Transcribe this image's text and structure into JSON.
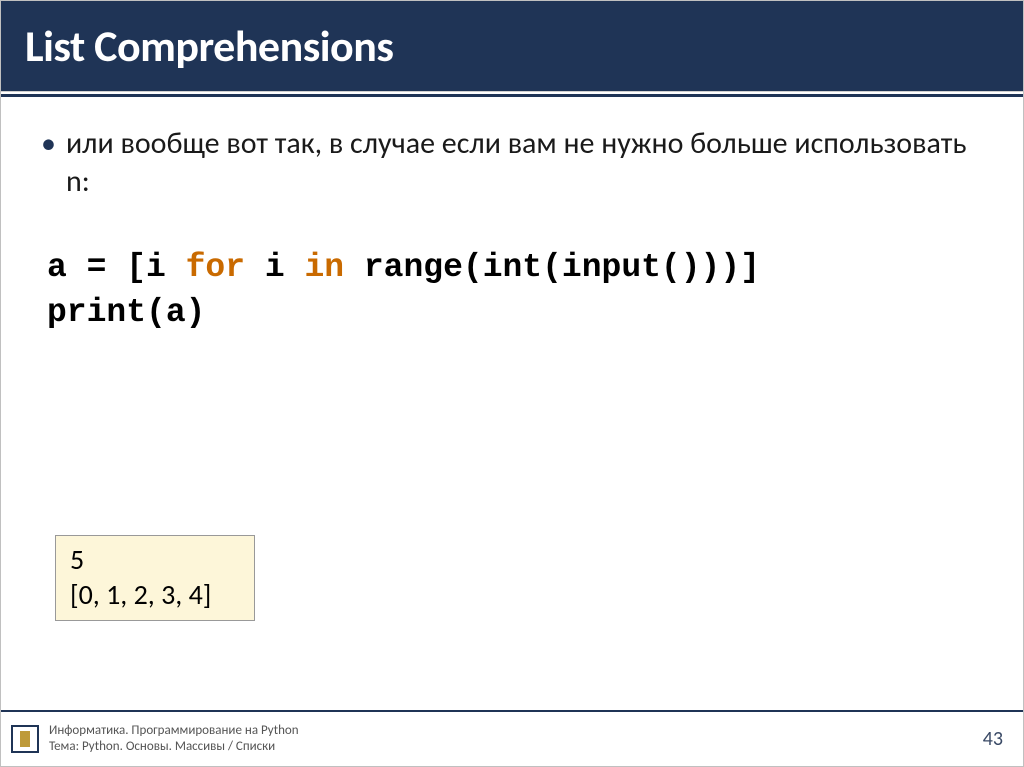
{
  "header": {
    "title": "List Comprehensions"
  },
  "body": {
    "bullet_text": "или вообще вот так, в случае если вам не нужно больше использовать n:"
  },
  "code": {
    "line1": {
      "p1": "a = [i ",
      "kw1": "for",
      "p2": " i ",
      "kw2": "in",
      "p3": " range(int(input()))]"
    },
    "line2": "print(a)"
  },
  "output": {
    "line1": "5",
    "line2": "[0, 1, 2, 3, 4]"
  },
  "footer": {
    "line1": "Информатика. Программирование на Python",
    "line2": "Тема: Python. Основы. Массивы / Списки",
    "page": "43"
  }
}
